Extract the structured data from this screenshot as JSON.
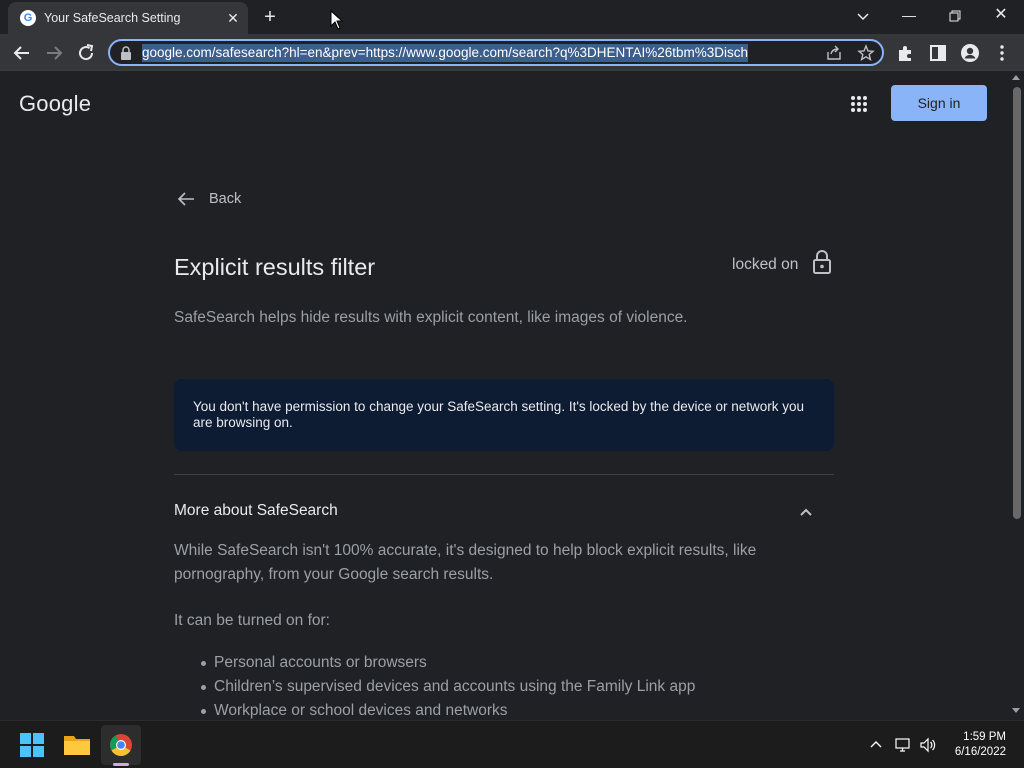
{
  "browser": {
    "tab": {
      "title": "Your SafeSearch Setting",
      "favicon": "google-g-icon"
    },
    "url": "google.com/safesearch?hl=en&prev=https://www.google.com/search?q%3DHENTAI%26tbm%3Disch",
    "accent": "#8ab4f8"
  },
  "header": {
    "logo": "Google",
    "sign_in": "Sign in"
  },
  "content": {
    "back": "Back",
    "title": "Explicit results filter",
    "status": "locked on",
    "description": "SafeSearch helps hide results with explicit content, like images of violence.",
    "notice": "You don't have permission to change your SafeSearch setting. It's locked by the device or network you are browsing on.",
    "more": {
      "title": "More about SafeSearch",
      "paragraph": "While SafeSearch isn't 100% accurate, it's designed to help block explicit results, like pornography, from your Google search results.",
      "turned_on_label": "It can be turned on for:",
      "items": [
        "Personal accounts or browsers",
        "Children’s supervised devices and accounts using the Family Link app",
        "Workplace or school devices and networks"
      ]
    }
  },
  "taskbar": {
    "time": "1:59 PM",
    "date": "6/16/2022"
  }
}
